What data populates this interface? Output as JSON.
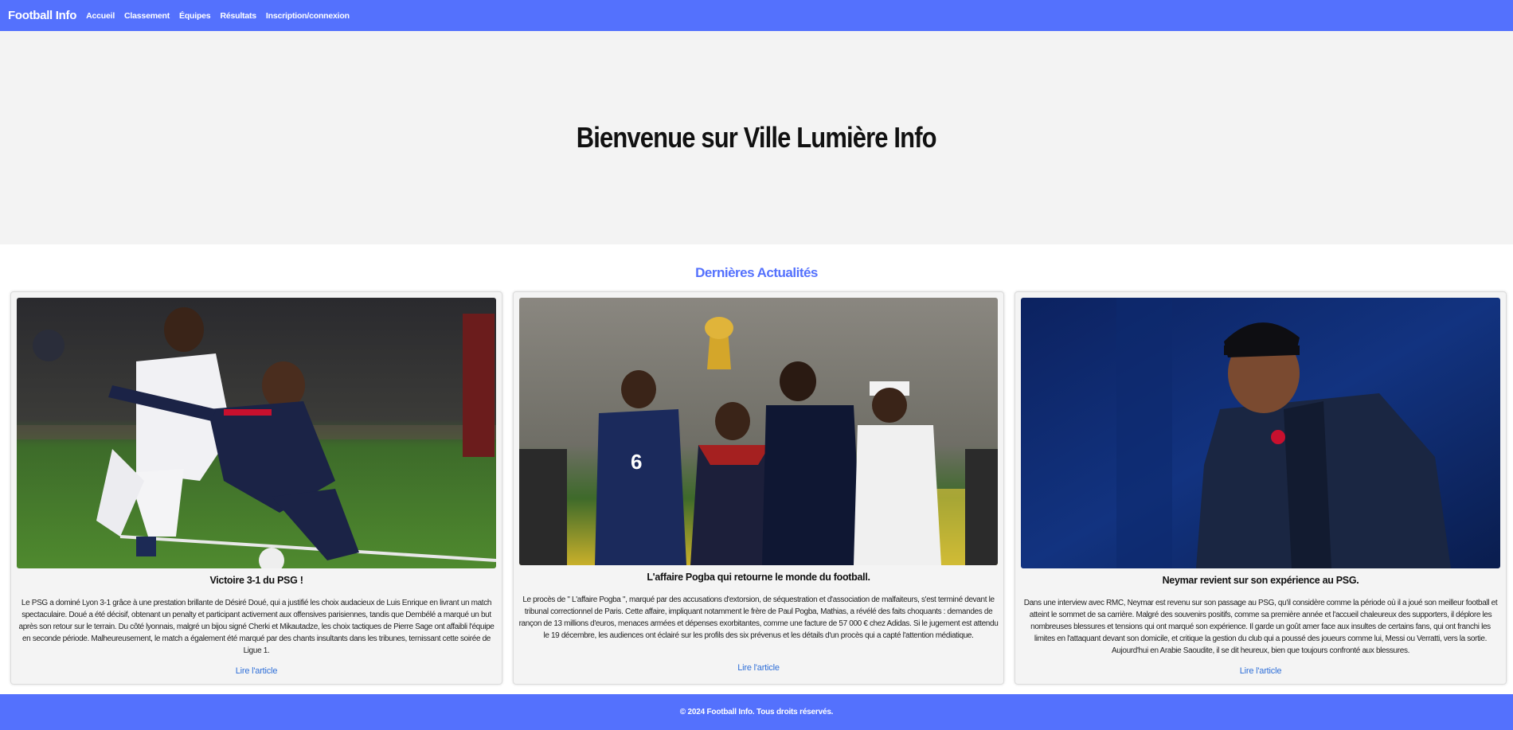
{
  "nav": {
    "brand": "Football Info",
    "links": [
      "Accueil",
      "Classement",
      "Équipes",
      "Résultats",
      "Inscription/connexion"
    ]
  },
  "hero": {
    "title": "Bienvenue sur Ville Lumière Info"
  },
  "news": {
    "section_title": "Dernières Actualités",
    "cards": [
      {
        "title": "Victoire 3-1 du PSG !",
        "text": "Le PSG a dominé Lyon 3-1 grâce à une prestation brillante de Désiré Doué, qui a justifié les choix audacieux de Luis Enrique en livrant un match spectaculaire. Doué a été décisif, obtenant un penalty et participant activement aux offensives parisiennes, tandis que Dembélé a marqué un but après son retour sur le terrain. Du côté lyonnais, malgré un bijou signé Cherki et Mikautadze, les choix tactiques de Pierre Sage ont affaibli l'équipe en seconde période. Malheureusement, le match a également été marqué par des chants insultants dans les tribunes, ternissant cette soirée de Ligue 1.",
        "link": "Lire l'article"
      },
      {
        "title": "L'affaire Pogba qui retourne le monde du football.",
        "text": "Le procès de \" L'affaire Pogba \", marqué par des accusations d'extorsion, de séquestration et d'association de malfaiteurs, s'est terminé devant le tribunal correctionnel de Paris. Cette affaire, impliquant notamment le frère de Paul Pogba, Mathias, a révélé des faits choquants : demandes de rançon de 13 millions d'euros, menaces armées et dépenses exorbitantes, comme une facture de 57 000 € chez Adidas. Si le jugement est attendu le 19 décembre, les audiences ont éclairé sur les profils des six prévenus et les détails d'un procès qui a capté l'attention médiatique.",
        "link": "Lire l'article"
      },
      {
        "title": "Neymar revient sur son expérience au PSG.",
        "text": "Dans une interview avec RMC, Neymar est revenu sur son passage au PSG, qu'il considère comme la période où il a joué son meilleur football et atteint le sommet de sa carrière. Malgré des souvenirs positifs, comme sa première année et l'accueil chaleureux des supporters, il déplore les nombreuses blessures et tensions qui ont marqué son expérience. Il garde un goût amer face aux insultes de certains fans, qui ont franchi les limites en l'attaquant devant son domicile, et critique la gestion du club qui a poussé des joueurs comme lui, Messi ou Verratti, vers la sortie. Aujourd'hui en Arabie Saoudite, il se dit heureux, bien que toujours confronté aux blessures.",
        "link": "Lire l'article"
      }
    ]
  },
  "footer": {
    "text": "© 2024 Football Info. Tous droits réservés."
  },
  "colors": {
    "brand_blue": "#5471fd",
    "link_blue": "#2f6fd8",
    "hero_bg": "#f3f3f3"
  }
}
